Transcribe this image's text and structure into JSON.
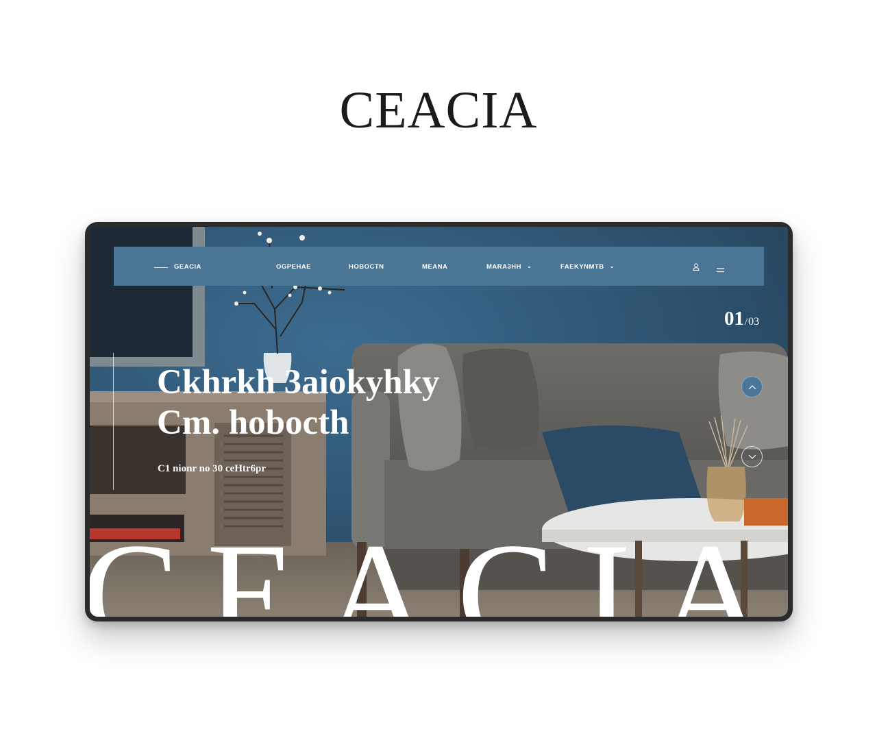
{
  "brand": {
    "title": "CEACIA"
  },
  "nav": {
    "logo": "GEACIA",
    "items": [
      {
        "label": "OGPEHAE",
        "has_caret": false
      },
      {
        "label": "HOBOCTN",
        "has_caret": false
      },
      {
        "label": "MEANA",
        "has_caret": false
      },
      {
        "label": "MARA3HH",
        "has_caret": true
      },
      {
        "label": "FAEKYNMTB",
        "has_caret": true
      }
    ],
    "icons": [
      "user-icon",
      "menu-icon"
    ]
  },
  "hero": {
    "slide_current": "01",
    "slide_separator": "/",
    "slide_total": "03",
    "headline_line1": "Ckhrkh 3aiokyhky",
    "headline_line2": "Cm. hobocth",
    "subline": "C1 nionr no 30 ceHtr6pr",
    "giant_word": "CEACIA"
  },
  "colors": {
    "nav_bg": "#4a7595",
    "wall": "#325e80",
    "accent_button": "#4a7799"
  }
}
